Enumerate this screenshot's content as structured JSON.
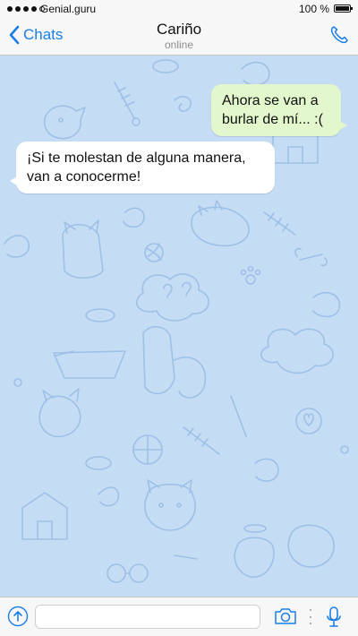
{
  "status_bar": {
    "carrier": "Genial.guru",
    "battery": "100 %"
  },
  "nav": {
    "back_label": "Chats",
    "title": "Cariño",
    "subtitle": "online"
  },
  "messages": [
    {
      "direction": "outgoing",
      "text": "Ahora se van a burlar de mí... :("
    },
    {
      "direction": "incoming",
      "text": "¡Si te molestan de alguna manera, van a conocerme!"
    }
  ],
  "input": {
    "value": "",
    "placeholder": ""
  },
  "icons": {
    "back": "chevron-left-icon",
    "call": "phone-icon",
    "attach": "attach-arrow-up-icon",
    "camera": "camera-icon",
    "mic": "microphone-icon"
  },
  "colors": {
    "accent": "#1a7ee6",
    "chat_background": "#c5dcf5",
    "outgoing_bubble": "#e2f7cb",
    "incoming_bubble": "#ffffff"
  }
}
